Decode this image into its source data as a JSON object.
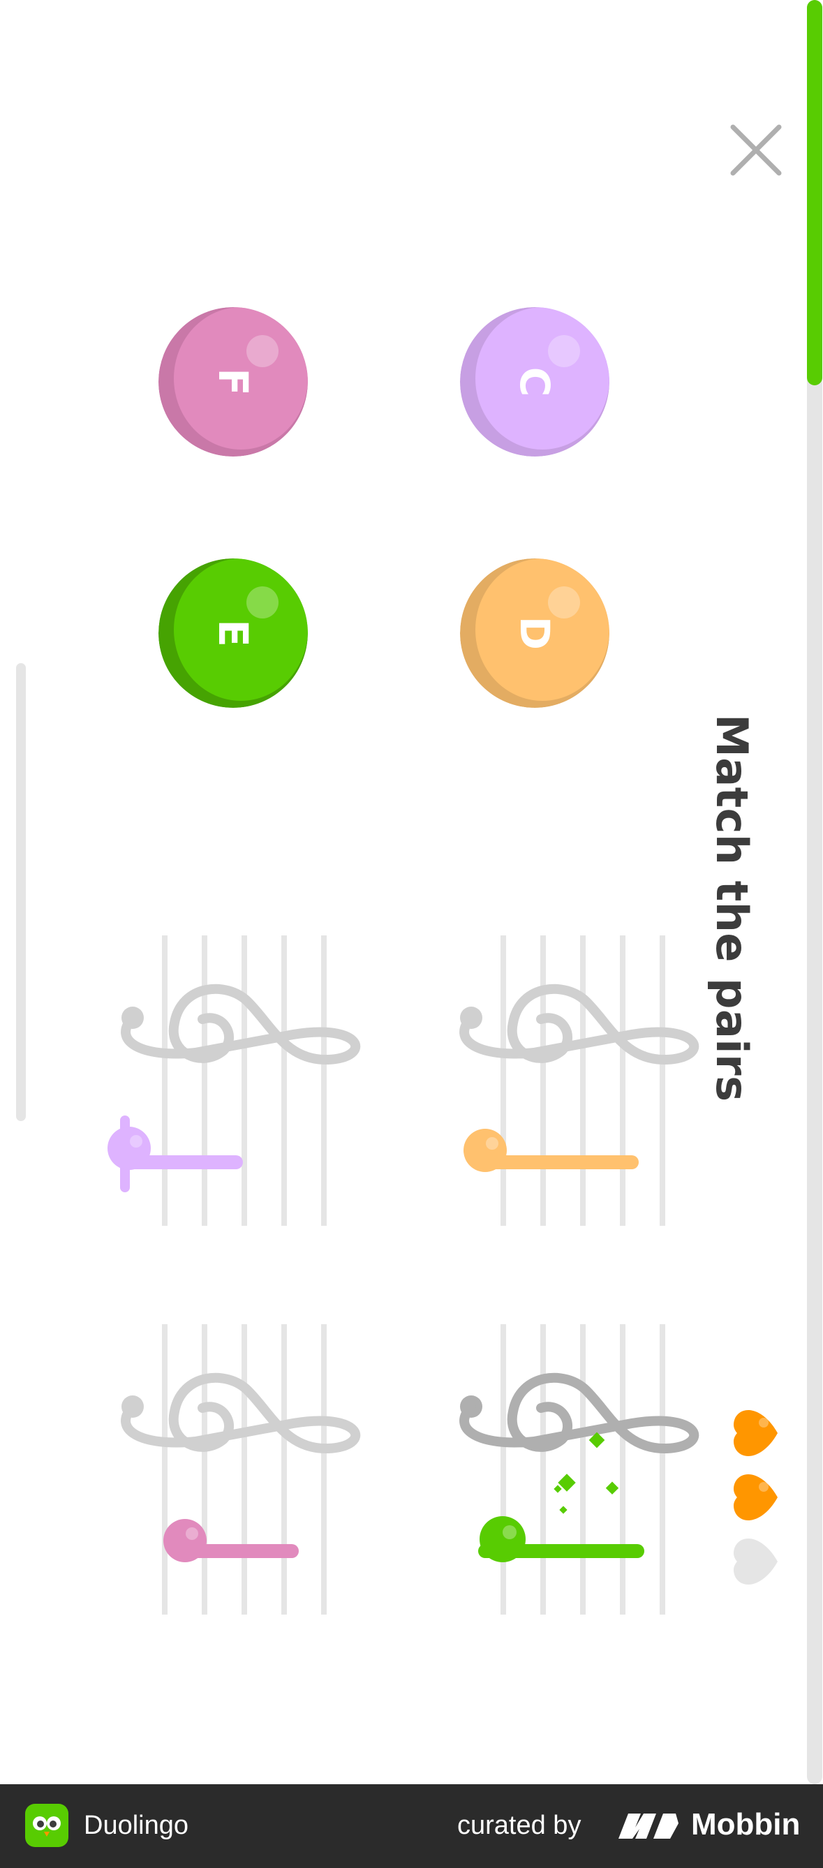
{
  "header": {
    "close_icon": "close-icon",
    "progress_fraction": 0.216
  },
  "title": "Match the pairs",
  "colors": {
    "pink": "#e18abd",
    "pink_shade": "#c978a8",
    "lilac": "#deb3ff",
    "lilac_shade": "#c79fe3",
    "green": "#58cc02",
    "green_shade": "#46a302",
    "orange": "#ffc16e",
    "orange_shade": "#e3ac62",
    "staff_line": "#e5e5e5",
    "clef": "#d0d0d0",
    "clef_active": "#afafaf",
    "heart": "#ff9600",
    "heart_empty": "#e5e5e5"
  },
  "note_buttons": [
    {
      "letter": "F",
      "color": "pink"
    },
    {
      "letter": "C",
      "color": "lilac"
    },
    {
      "letter": "E",
      "color": "green"
    },
    {
      "letter": "D",
      "color": "orange"
    }
  ],
  "staff_cards": [
    {
      "note_color": "lilac",
      "state": "default"
    },
    {
      "note_color": "orange",
      "state": "default"
    },
    {
      "note_color": "pink",
      "state": "default"
    },
    {
      "note_color": "green",
      "state": "selected"
    }
  ],
  "hearts": {
    "filled": 2,
    "total": 3
  },
  "footer": {
    "app_name": "Duolingo",
    "curated_by": "curated by",
    "brand": "Mobbin"
  }
}
